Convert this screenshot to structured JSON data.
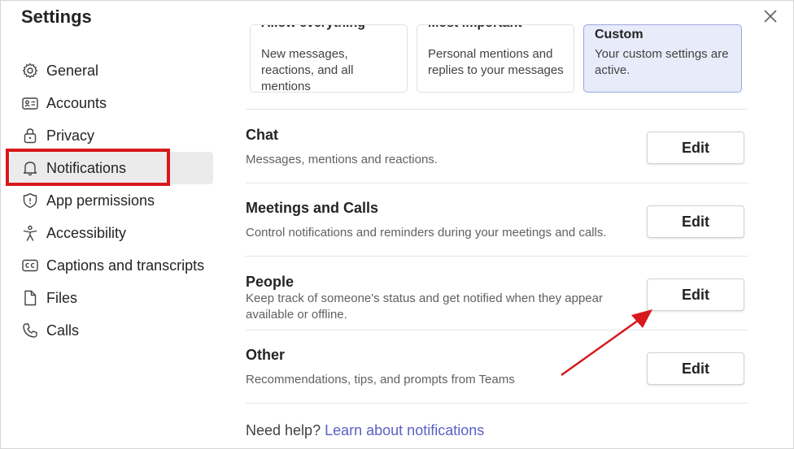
{
  "window": {
    "title": "Settings"
  },
  "nav": {
    "items": [
      {
        "label": "General",
        "icon": "gear-icon"
      },
      {
        "label": "Accounts",
        "icon": "id-card-icon"
      },
      {
        "label": "Privacy",
        "icon": "lock-icon"
      },
      {
        "label": "Notifications",
        "icon": "bell-icon",
        "active": true
      },
      {
        "label": "App permissions",
        "icon": "shield-icon"
      },
      {
        "label": "Accessibility",
        "icon": "accessibility-icon"
      },
      {
        "label": "Captions and transcripts",
        "icon": "captions-icon"
      },
      {
        "label": "Files",
        "icon": "file-icon"
      },
      {
        "label": "Calls",
        "icon": "phone-icon"
      }
    ]
  },
  "presets": [
    {
      "title": "Allow everything",
      "desc": "New messages, reactions, and all mentions"
    },
    {
      "title": "Most important",
      "desc": "Personal mentions and replies to your messages"
    },
    {
      "title": "Custom",
      "desc": "Your custom settings are active.",
      "selected": true
    }
  ],
  "sections": [
    {
      "heading": "Chat",
      "desc": "Messages, mentions and reactions.",
      "button": "Edit"
    },
    {
      "heading": "Meetings and Calls",
      "desc": "Control notifications and reminders during your meetings and calls.",
      "button": "Edit"
    },
    {
      "heading": "People",
      "desc": "Keep track of someone's status and get notified when they appear available or offline.",
      "button": "Edit"
    },
    {
      "heading": "Other",
      "desc": "Recommendations, tips, and prompts from Teams",
      "button": "Edit"
    }
  ],
  "help": {
    "prefix": "Need help?",
    "link": "Learn about notifications"
  },
  "colors": {
    "accent": "#5b5fc7",
    "highlight": "#d7191c",
    "selected_card": "#e8ebfa"
  }
}
